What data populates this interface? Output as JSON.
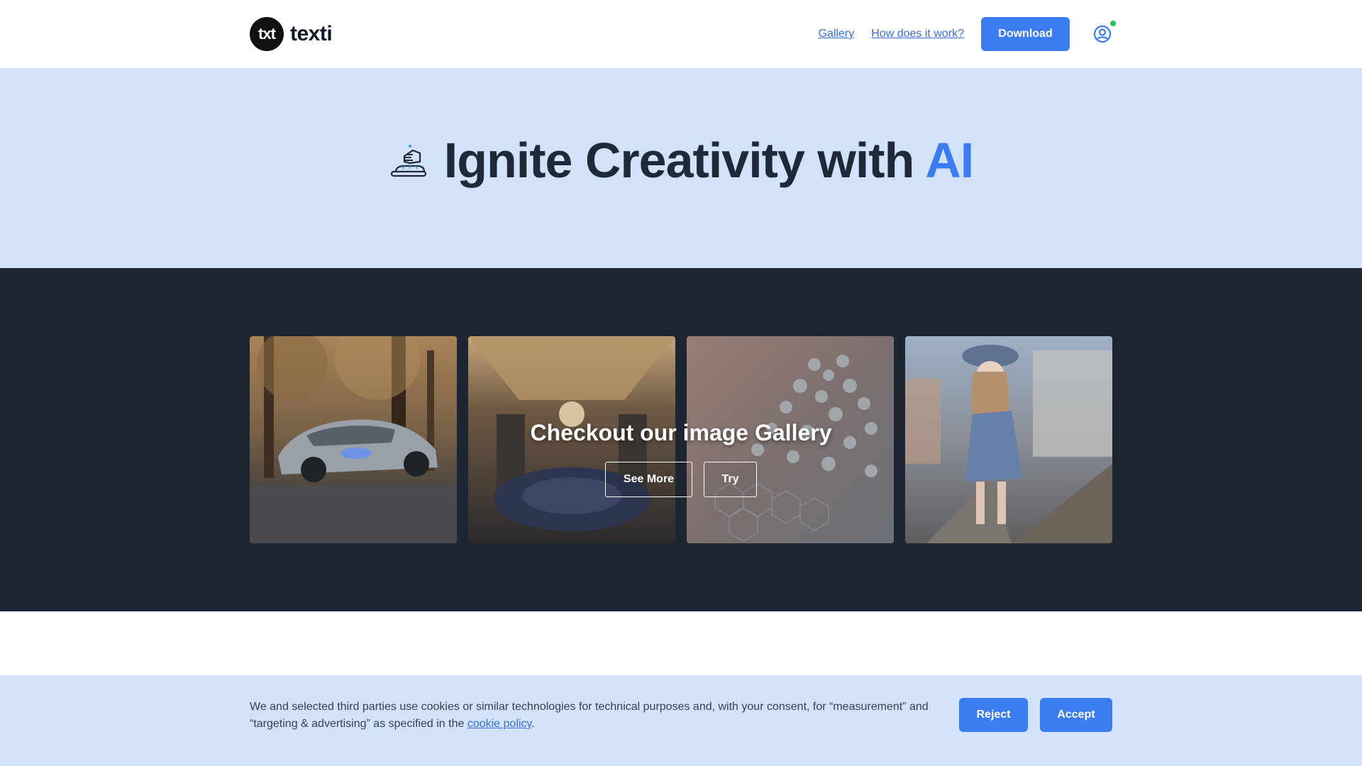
{
  "header": {
    "logo_mark": "txt",
    "logo_text": "texti",
    "nav": [
      {
        "label": "Gallery"
      },
      {
        "label": "How does it work?"
      }
    ],
    "download_label": "Download",
    "accent_color": "#3b7cf0",
    "user_icon": "user-circle-icon",
    "status_dot_color": "#22c55e"
  },
  "hero": {
    "title_main": "Ignite Creativity with",
    "title_accent": "AI",
    "icon": "hand-sparkle-icon",
    "background": "#d2e2fa"
  },
  "gallery": {
    "title": "Checkout our image Gallery",
    "see_more_label": "See More",
    "try_label": "Try",
    "background": "#1f2633",
    "tiles": [
      {
        "subject": "car-in-forest-image"
      },
      {
        "subject": "chandelier-hall-image"
      },
      {
        "subject": "molecule-spheres-image"
      },
      {
        "subject": "anime-girl-bridge-image"
      }
    ]
  },
  "cookie": {
    "text_before": "We and selected third parties use cookies or similar technologies for technical purposes and, with your consent, for “measurement” and “targeting & advertising” as specified in the ",
    "link": "cookie policy",
    "text_after": ".",
    "reject_label": "Reject",
    "accept_label": "Accept"
  }
}
